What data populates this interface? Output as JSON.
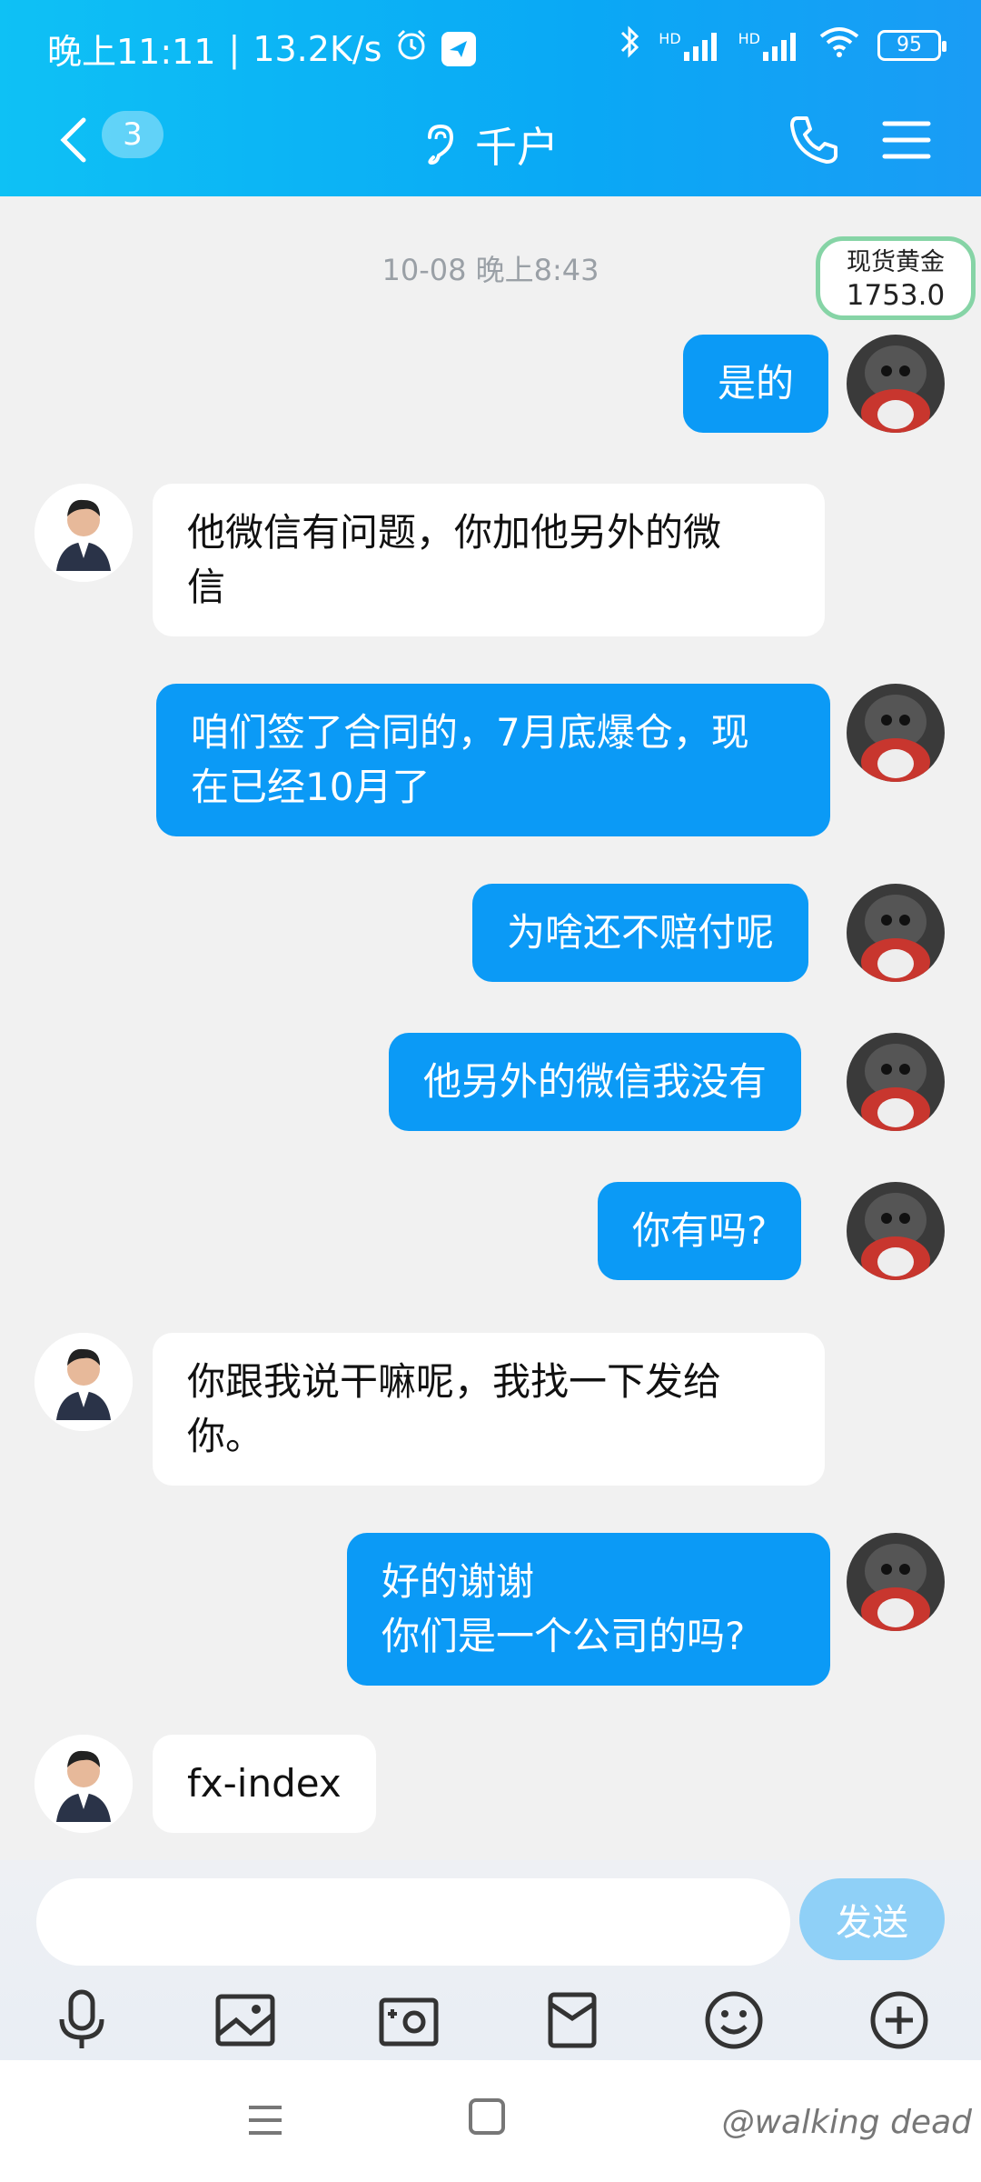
{
  "status": {
    "time": "晚上11:11",
    "speed": "13.2K/s",
    "battery": "95",
    "hd1": "HD",
    "hd2": "HD"
  },
  "header": {
    "unread_count": "3",
    "title": "千户"
  },
  "chat": {
    "timestamp": "10-08 晚上8:43",
    "ticker": {
      "label": "现货黄金",
      "value": "1753.0"
    },
    "messages": [
      {
        "side": "me",
        "text": "是的"
      },
      {
        "side": "them",
        "text": "他微信有问题，你加他另外的微\n信"
      },
      {
        "side": "me",
        "text": "咱们签了合同的，7月底爆仓，现\n在已经10月了"
      },
      {
        "side": "me",
        "text": "为啥还不赔付呢"
      },
      {
        "side": "me",
        "text": "他另外的微信我没有"
      },
      {
        "side": "me",
        "text": "你有吗?"
      },
      {
        "side": "them",
        "text": "你跟我说干嘛呢，我找一下发给\n你。"
      },
      {
        "side": "me",
        "text": "好的谢谢\n你们是一个公司的吗?"
      },
      {
        "side": "them",
        "text": "fx-index"
      }
    ]
  },
  "composer": {
    "send_label": "发送",
    "tools": [
      "microphone-icon",
      "image-icon",
      "camera-icon",
      "red-packet-icon",
      "emoji-icon",
      "plus-icon"
    ]
  },
  "watermark": "@walking dead",
  "colors": {
    "my_bubble": "#0b9af6",
    "their_bubble": "#ffffff",
    "header_blue": "#0aa8f5"
  }
}
